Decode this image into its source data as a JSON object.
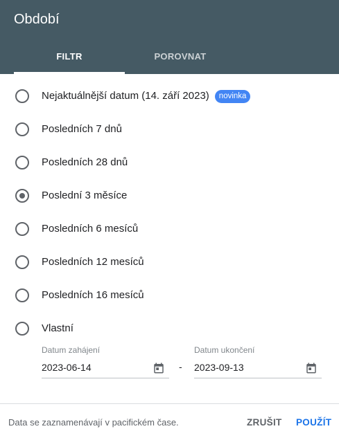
{
  "dialog": {
    "title": "Období",
    "tabs": [
      {
        "label": "FILTR",
        "active": true
      },
      {
        "label": "POROVNAT",
        "active": false
      }
    ],
    "header_color": "#455a64"
  },
  "options": [
    {
      "label": "Nejaktuálnější datum (14. září 2023)",
      "badge": "novinka",
      "selected": false
    },
    {
      "label": "Posledních 7 dnů",
      "selected": false
    },
    {
      "label": "Posledních 28 dnů",
      "selected": false
    },
    {
      "label": "Poslední 3 měsíce",
      "selected": true
    },
    {
      "label": "Posledních 6 mesíců",
      "selected": false
    },
    {
      "label": "Posledních 12 mesíců",
      "selected": false
    },
    {
      "label": "Posledních 16 mesíců",
      "selected": false
    },
    {
      "label": "Vlastní",
      "selected": false
    }
  ],
  "custom_range": {
    "start_label": "Datum zahájení",
    "start_value": "2023-06-14",
    "separator": "-",
    "end_label": "Datum ukončení",
    "end_value": "2023-09-13"
  },
  "footer": {
    "note": "Data se zaznamenávají v pacifickém čase.",
    "cancel_label": "ZRUŠIT",
    "apply_label": "POUŽÍT",
    "accent_color": "#1a73e8"
  },
  "badge_color": "#4285f4"
}
